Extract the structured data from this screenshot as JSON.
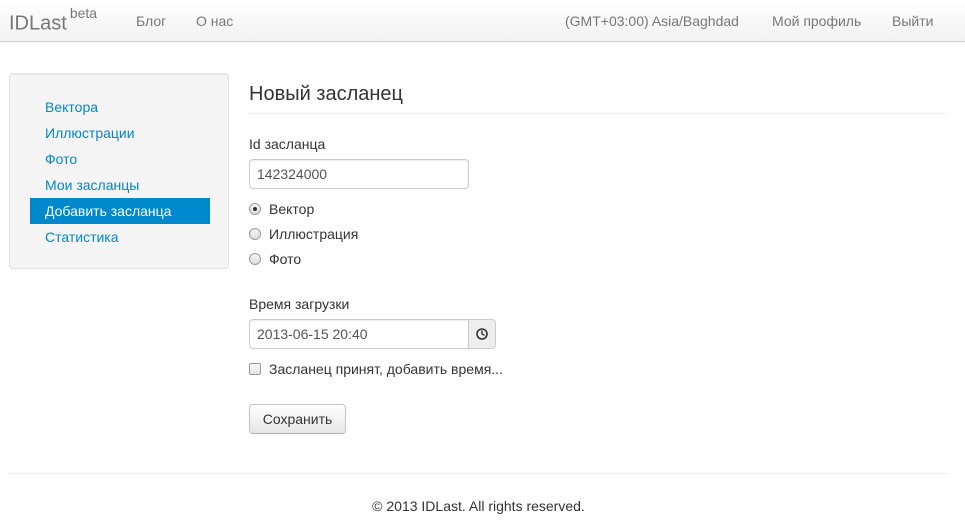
{
  "navbar": {
    "brand": "IDLast",
    "brand_badge": "beta",
    "links": [
      "Блог",
      "О нас"
    ],
    "timezone": "(GMT+03:00) Asia/Baghdad",
    "profile": "Мой профиль",
    "logout": "Выйти"
  },
  "sidebar": {
    "items": [
      {
        "label": "Вектора",
        "active": false
      },
      {
        "label": "Иллюстрации",
        "active": false
      },
      {
        "label": "Фото",
        "active": false
      },
      {
        "label": "Мои засланцы",
        "active": false
      },
      {
        "label": "Добавить засланца",
        "active": true
      },
      {
        "label": "Статистика",
        "active": false
      }
    ]
  },
  "form": {
    "title": "Новый засланец",
    "id_label": "Id засланца",
    "id_value": "142324000",
    "radio_options": [
      {
        "label": "Вектор",
        "checked": true
      },
      {
        "label": "Иллюстрация",
        "checked": false
      },
      {
        "label": "Фото",
        "checked": false
      }
    ],
    "upload_label": "Время загрузки",
    "upload_value": "2013-06-15 20:40",
    "clock_icon": "clock-icon",
    "accepted_label": "Засланец принят, добавить время...",
    "accepted_checked": false,
    "save_label": "Сохранить"
  },
  "footer": {
    "text": "© 2013 IDLast. All rights reserved."
  },
  "colors": {
    "link": "#0088cc",
    "active_bg": "#0088cc",
    "nav_text": "#777777"
  }
}
